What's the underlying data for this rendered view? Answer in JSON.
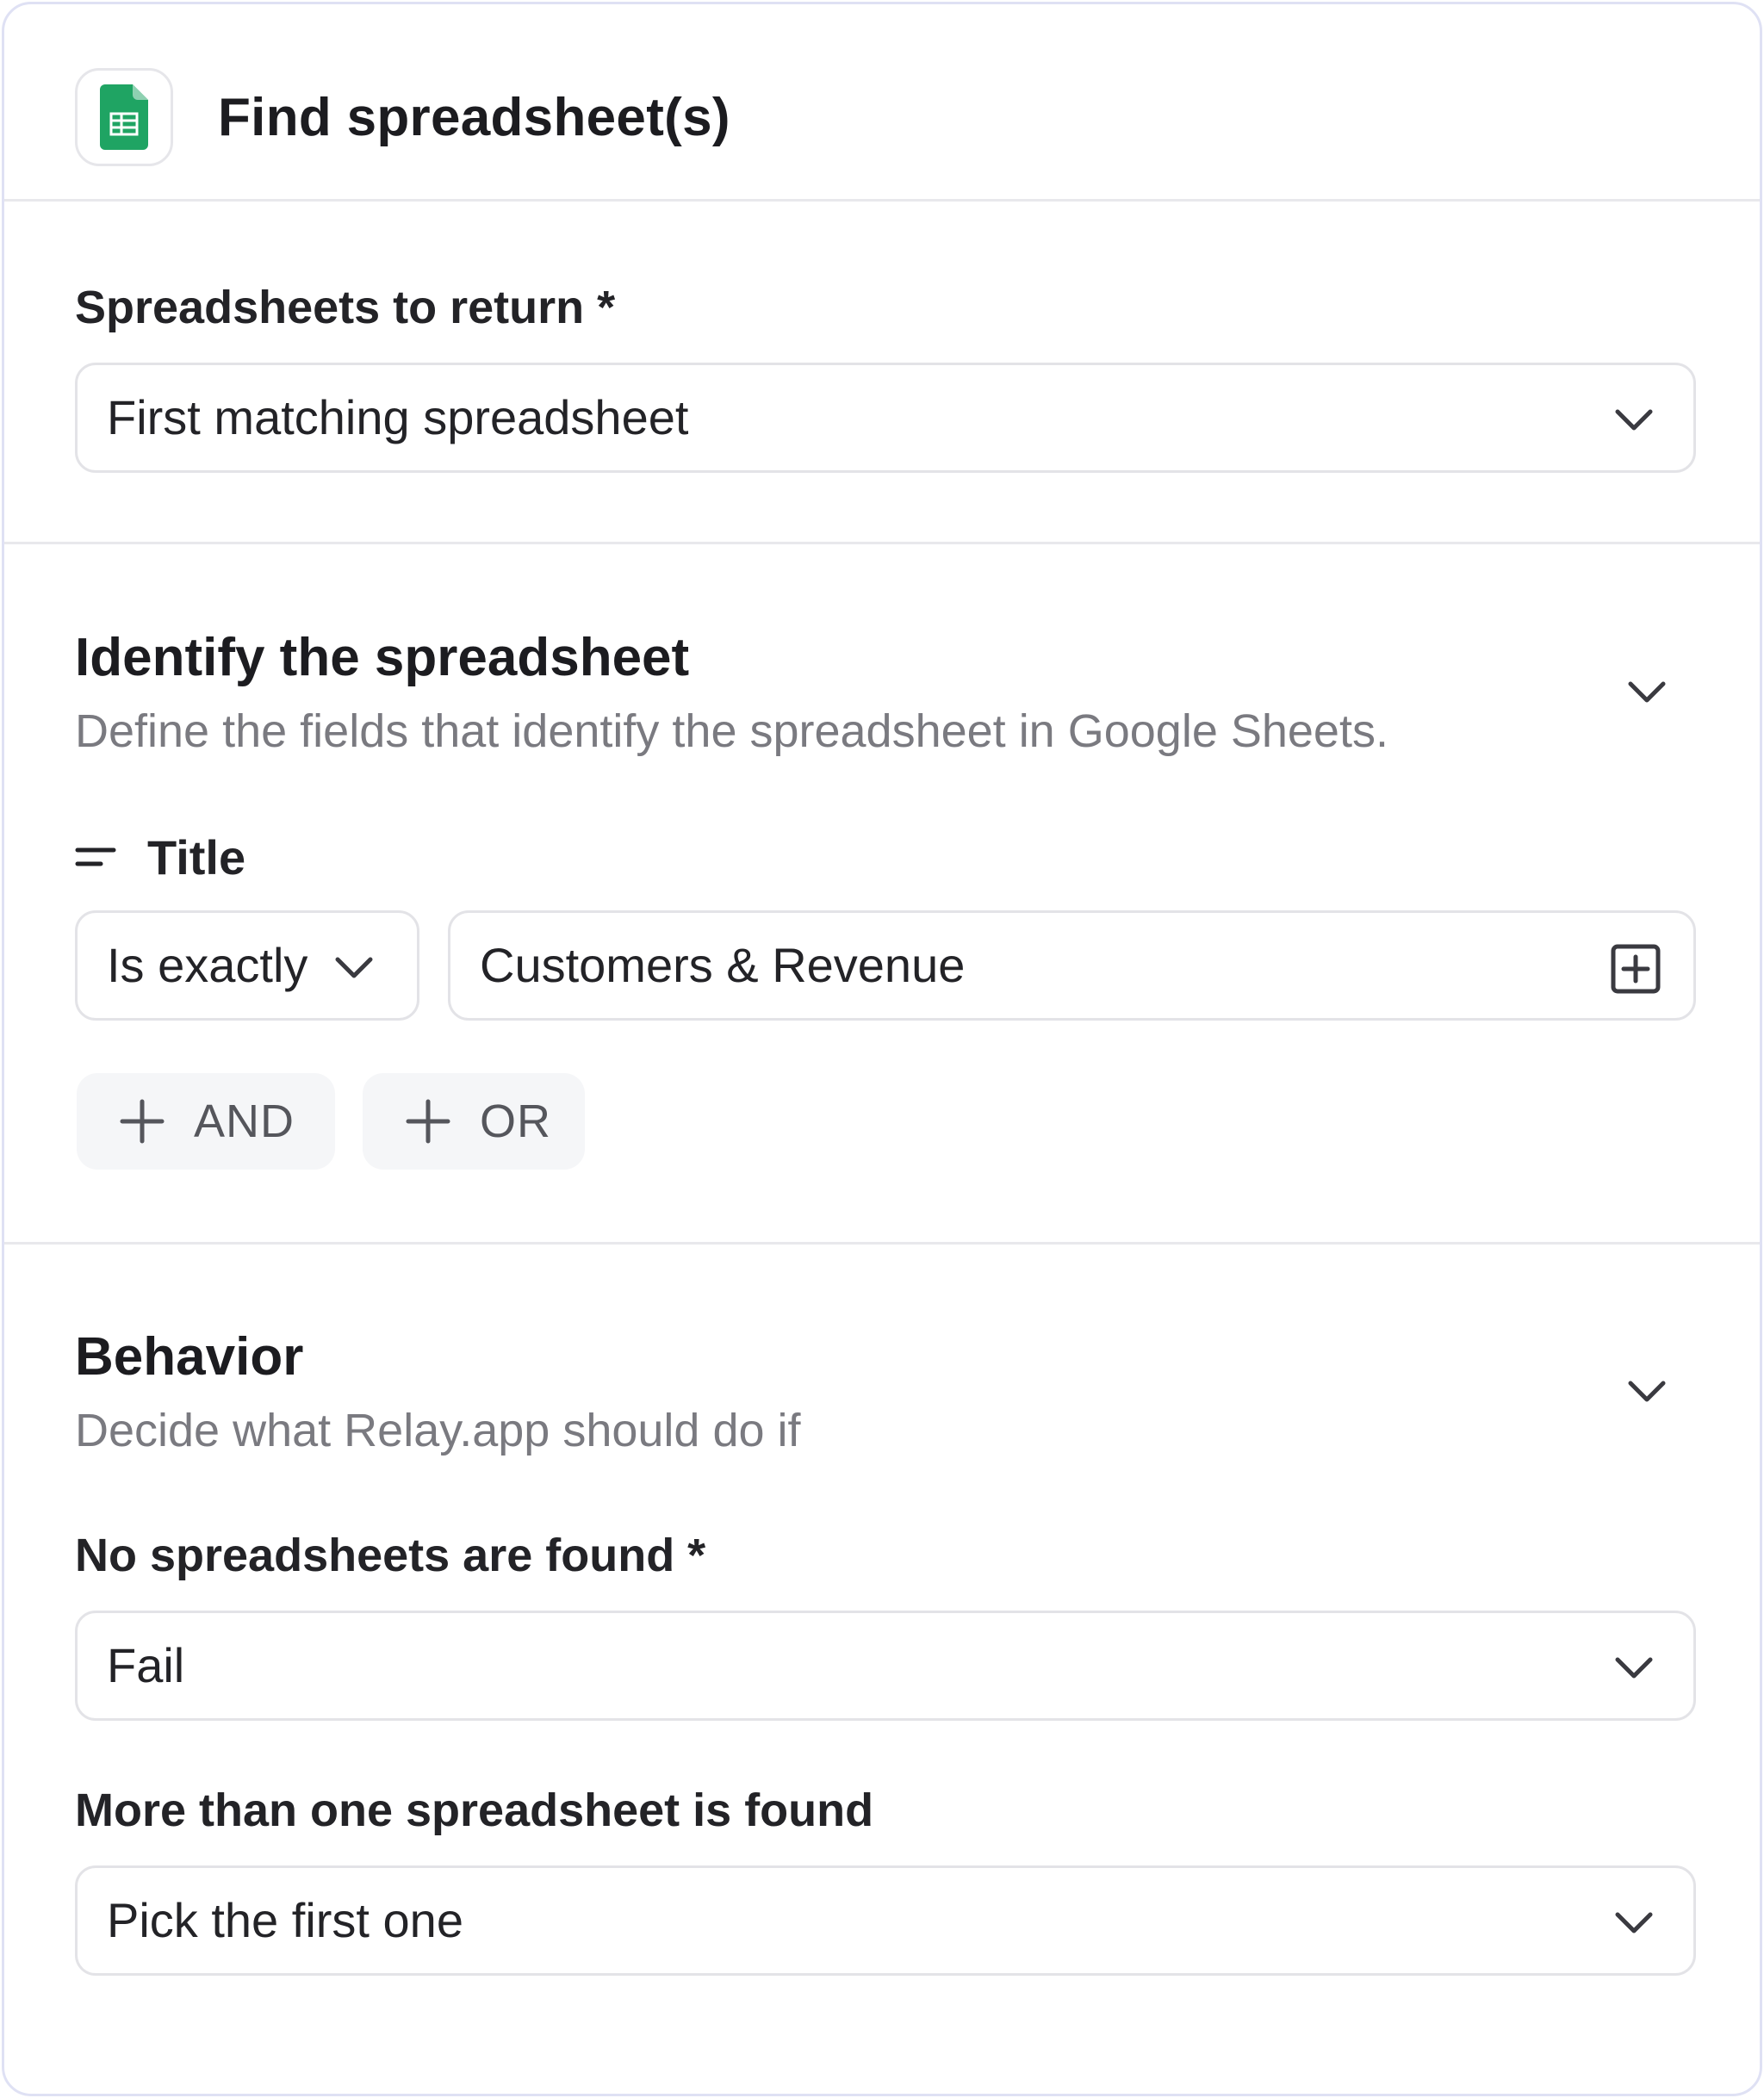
{
  "header": {
    "title": "Find spreadsheet(s)",
    "app_icon": "google-sheets-icon",
    "accent_color": "#1fa463"
  },
  "return_field": {
    "label": "Spreadsheets to return *",
    "value": "First matching spreadsheet"
  },
  "identify": {
    "title": "Identify the spreadsheet",
    "description": "Define the fields that identify the spreadsheet in Google Sheets.",
    "filter": {
      "field_label": "Title",
      "operator": "Is exactly",
      "value": "Customers & Revenue"
    },
    "and_label": "AND",
    "or_label": "OR"
  },
  "behavior": {
    "title": "Behavior",
    "description": "Decide what Relay.app should do if",
    "none_found": {
      "label": "No spreadsheets are found *",
      "value": "Fail"
    },
    "multiple_found": {
      "label": "More than one spreadsheet is found",
      "value": "Pick the first one"
    }
  }
}
